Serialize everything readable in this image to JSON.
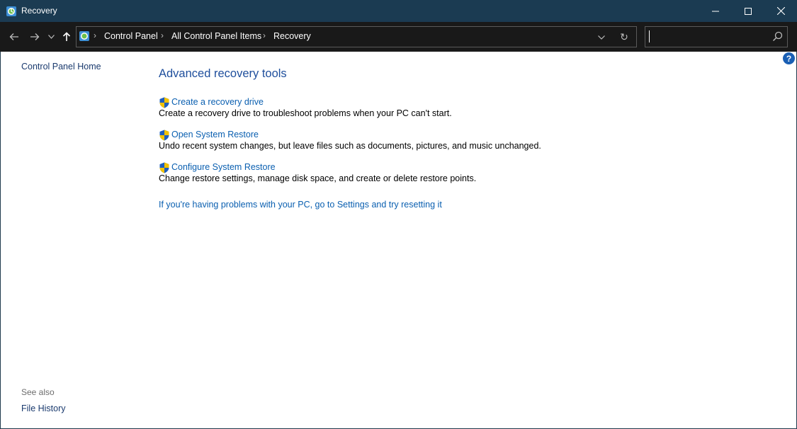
{
  "window": {
    "title": "Recovery"
  },
  "nav": {
    "breadcrumbs": [
      "Control Panel",
      "All Control Panel Items",
      "Recovery"
    ],
    "search": {
      "value": "",
      "placeholder": ""
    }
  },
  "sidebar": {
    "home_link": "Control Panel Home",
    "see_also_heading": "See also",
    "see_also_links": [
      "File History"
    ]
  },
  "main": {
    "heading": "Advanced recovery tools",
    "tools": [
      {
        "label": "Create a recovery drive",
        "description": "Create a recovery drive to troubleshoot problems when your PC can't start."
      },
      {
        "label": "Open System Restore",
        "description": "Undo recent system changes, but leave files such as documents, pictures, and music unchanged."
      },
      {
        "label": "Configure System Restore",
        "description": "Change restore settings, manage disk space, and create or delete restore points."
      }
    ],
    "reset_link": "If you're having problems with your PC, go to Settings and try resetting it"
  },
  "colors": {
    "titlebar": "#1b3b52",
    "navbar": "#191919",
    "link": "#0a5fb0",
    "heading": "#1e4e9c"
  },
  "icons": [
    "recovery-app-icon",
    "back-arrow-icon",
    "forward-arrow-icon",
    "chevron-down-icon",
    "up-arrow-icon",
    "refresh-icon",
    "search-icon",
    "uac-shield-icon",
    "help-icon",
    "minimize-icon",
    "maximize-icon",
    "close-icon"
  ]
}
